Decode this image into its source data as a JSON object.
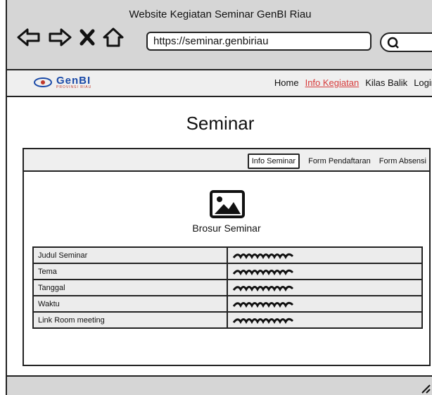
{
  "window": {
    "title": "Website Kegiatan Seminar GenBI Riau"
  },
  "browser": {
    "url": "https://seminar.genbiriau"
  },
  "logo": {
    "main": "GenBI",
    "sub": "PROVINSI RIAU"
  },
  "menu": [
    "Home",
    "Info Kegiatan",
    "Kilas Balik",
    "Login"
  ],
  "page": {
    "title": "Seminar"
  },
  "tabs": [
    "Info Seminar",
    "Form Pendaftaran",
    "Form Absensi"
  ],
  "brochure": {
    "caption": "Brosur Seminar"
  },
  "info_rows": [
    "Judul Seminar",
    "Tema",
    "Tanggal",
    "Waktu",
    "Link Room meeting"
  ]
}
